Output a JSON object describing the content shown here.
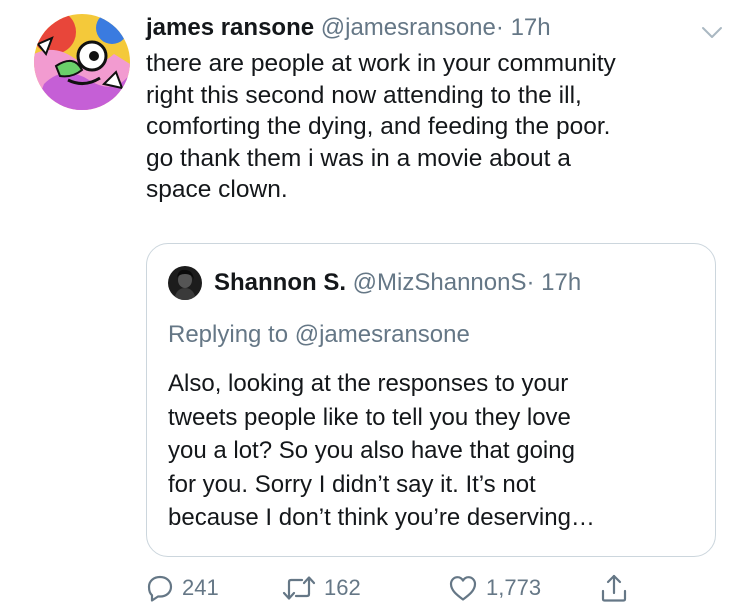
{
  "tweet": {
    "author_name": "james ransone",
    "author_handle": "@jamesransone",
    "separator": "·",
    "time": "17h",
    "text_lines": [
      "there are people at work in your community",
      "right this second now attending to the ill,",
      "comforting the dying, and feeding the poor.",
      "go thank them i was in a movie about a",
      "space clown."
    ]
  },
  "quoted_tweet": {
    "author_name": "Shannon S.",
    "author_handle": "@MizShannonS",
    "separator": "·",
    "time": "17h",
    "replying_to": "Replying to @jamesransone",
    "text_lines": [
      "Also, looking at the responses to your",
      "tweets people like to tell you they love",
      "you a lot? So you also have that going",
      "for you. Sorry I didn’t say it. It’s not",
      "because I don’t think you’re deserving…"
    ]
  },
  "actions": {
    "reply_count": "241",
    "retweet_count": "162",
    "like_count": "1,773"
  },
  "icons": {
    "avatar": "cartoon-avatar-icon",
    "quoted_avatar": "user-avatar-icon",
    "menu": "chevron-down-icon",
    "reply": "reply-icon",
    "retweet": "retweet-icon",
    "like": "heart-icon",
    "share": "share-icon"
  },
  "colors": {
    "text": "#14171a",
    "secondary": "#657786",
    "border": "#ccd6dd"
  }
}
